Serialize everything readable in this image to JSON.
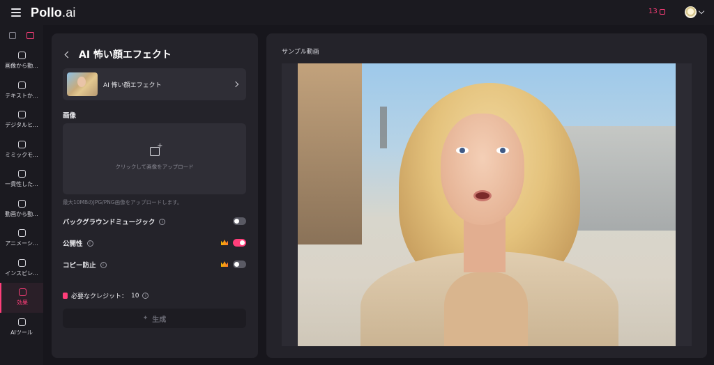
{
  "header": {
    "logo_main": "Pollo",
    "logo_suffix": ".ai",
    "credits": "13",
    "icons": {
      "menu": "hamburger-icon",
      "credits": "coin-icon",
      "avatar": "avatar",
      "dropdown": "chevron-down-icon"
    }
  },
  "sidebar": {
    "items": [
      {
        "label": "画像から動...",
        "icon": "image-to-video-icon"
      },
      {
        "label": "テキストか...",
        "icon": "text-to-video-icon"
      },
      {
        "label": "デジタルヒ...",
        "icon": "digital-human-icon"
      },
      {
        "label": "ミミックモ...",
        "icon": "mimic-motion-icon"
      },
      {
        "label": "一貫性した...",
        "icon": "consistent-character-icon"
      },
      {
        "label": "動画から動...",
        "icon": "video-to-video-icon"
      },
      {
        "label": "アニメーシ...",
        "icon": "animation-icon"
      },
      {
        "label": "インスピレ...",
        "icon": "inspiration-icon"
      },
      {
        "label": "効果",
        "icon": "effects-icon",
        "active": true
      },
      {
        "label": "AIツール",
        "icon": "ai-tools-icon"
      }
    ]
  },
  "left_panel": {
    "title": "AI 怖い顔エフェクト",
    "effect_name": "AI 怖い顔エフェクト",
    "image_section_label": "画像",
    "upload_text": "クリックして画像をアップロード",
    "upload_hint": "最大10MBのJPG/PNG画像をアップロードします。",
    "options": [
      {
        "label": "バックグラウンドミュージック",
        "premium": false,
        "on": false
      },
      {
        "label": "公開性",
        "premium": true,
        "on": true
      },
      {
        "label": "コピー防止",
        "premium": true,
        "on": false
      }
    ],
    "credit_label": "必要なクレジット：",
    "credit_value": "10",
    "generate_label": "生成"
  },
  "right_panel": {
    "sample_label": "サンプル動画"
  },
  "colors": {
    "accent": "#ff3e7a",
    "background": "#17161c",
    "panel": "#24232a",
    "card": "#2f2e36"
  }
}
